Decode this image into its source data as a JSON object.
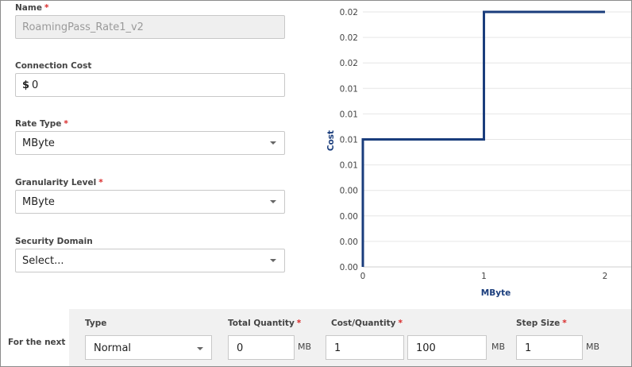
{
  "form": {
    "name_label": "Name",
    "name_value": "RoamingPass_Rate1_v2",
    "connection_cost_label": "Connection Cost",
    "connection_cost_currency": "$",
    "connection_cost_value": "0",
    "rate_type_label": "Rate Type",
    "rate_type_value": "MByte",
    "granularity_label": "Granularity Level",
    "granularity_value": "MByte",
    "security_domain_label": "Security Domain",
    "security_domain_placeholder": "Select...",
    "required_mark": "*"
  },
  "tier": {
    "for_next_label": "For the next",
    "type_label": "Type",
    "type_value": "Normal",
    "total_quantity_label": "Total Quantity",
    "total_quantity_value": "0",
    "total_quantity_unit": "MB",
    "cost_quantity_label": "Cost/Quantity",
    "cost_value": "1",
    "quantity_value": "100",
    "cost_quantity_unit": "MB",
    "step_size_label": "Step Size",
    "step_size_value": "1",
    "step_size_unit": "MB"
  },
  "chart_data": {
    "type": "line",
    "step": true,
    "xlabel": "MByte",
    "ylabel": "Cost",
    "x_ticks": [
      "0",
      "1",
      "2"
    ],
    "y_ticks": [
      "0.00",
      "0.00",
      "0.00",
      "0.00",
      "0.01",
      "0.01",
      "0.01",
      "0.01",
      "0.02",
      "0.02",
      "0.02"
    ],
    "xlim": [
      0,
      2
    ],
    "ylim": [
      0,
      0.02
    ],
    "grid": true,
    "series": [
      {
        "x": [
          0,
          0,
          1,
          1,
          2
        ],
        "y": [
          0,
          0.01,
          0.01,
          0.02,
          0.02
        ],
        "color": "#1a3d7c"
      }
    ]
  }
}
